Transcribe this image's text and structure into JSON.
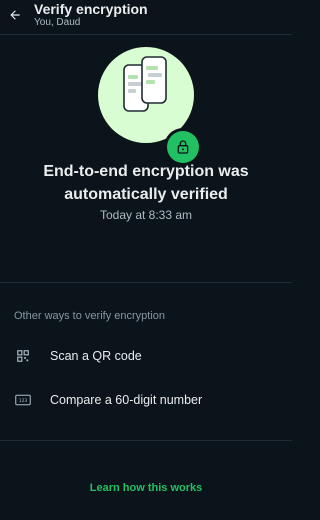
{
  "header": {
    "title": "Verify encryption",
    "subtitle": "You, Daud",
    "back_icon": "arrow-left-icon"
  },
  "hero": {
    "illustration_icon": "two-phones-icon",
    "badge_icon": "lock-icon",
    "headline_line1": "End-to-end encryption was",
    "headline_line2": "automatically verified",
    "time": "Today at 8:33 am"
  },
  "other_ways": {
    "label": "Other ways to verify encryption",
    "items": [
      {
        "label": "Scan a QR code",
        "icon": "qr-code-icon"
      },
      {
        "label": "Compare a 60-digit number",
        "icon": "number-123-icon"
      }
    ]
  },
  "footer": {
    "learn_label": "Learn how this works"
  },
  "colors": {
    "background": "#0b141a",
    "accent": "#21c063",
    "hero_circle": "#d9fdd3",
    "text": "#e9edef",
    "muted": "#8696a0"
  }
}
